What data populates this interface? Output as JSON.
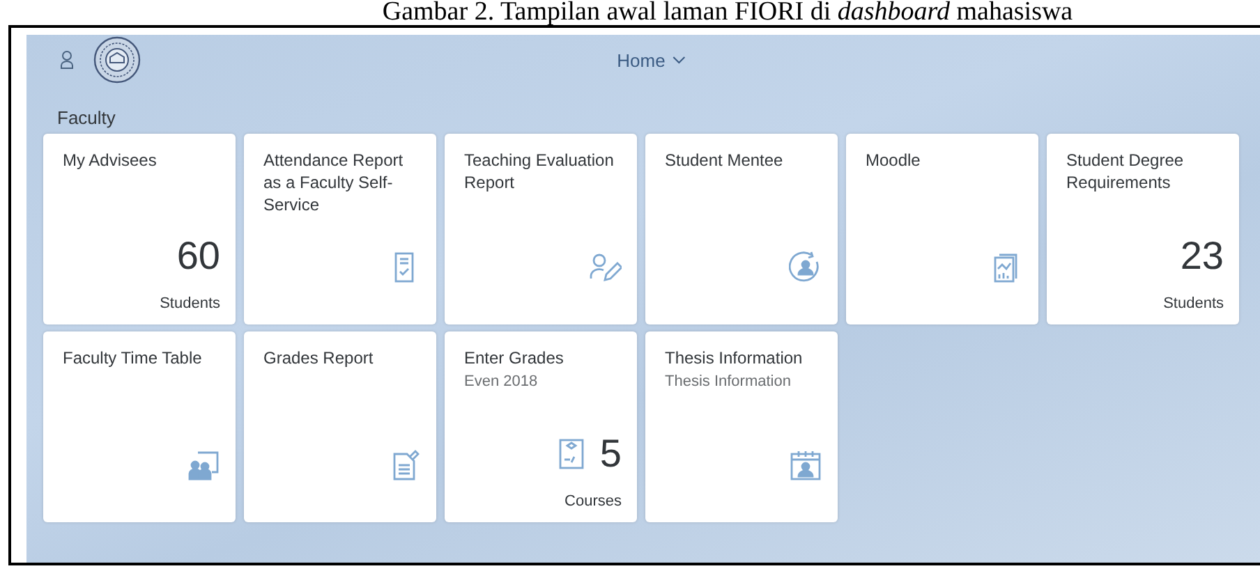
{
  "caption": "Gambar 2. Tampilan awal laman FIORI di *dashboard* mahasiswa",
  "header": {
    "title": "Home"
  },
  "group": {
    "title": "Faculty"
  },
  "tiles": [
    {
      "kind": "number",
      "title": "My Advisees",
      "number": "60",
      "unit": "Students"
    },
    {
      "kind": "icon",
      "title": "Attendance Report as a Faculty Self-Service"
    },
    {
      "kind": "icon",
      "title": "Teaching Evaluation Report"
    },
    {
      "kind": "icon",
      "title": "Student Mentee"
    },
    {
      "kind": "icon",
      "title": "Moodle"
    },
    {
      "kind": "number",
      "title": "Student Degree Requirements",
      "number": "23",
      "unit": "Students"
    },
    {
      "kind": "icon",
      "title": "Faculty Time Table"
    },
    {
      "kind": "icon",
      "title": "Grades Report"
    },
    {
      "kind": "number-icon",
      "title": "Enter Grades",
      "subtitle": "Even 2018",
      "number": "5",
      "unit": "Courses"
    },
    {
      "kind": "icon",
      "title": "Thesis Information",
      "subtitle": "Thesis Information"
    }
  ]
}
